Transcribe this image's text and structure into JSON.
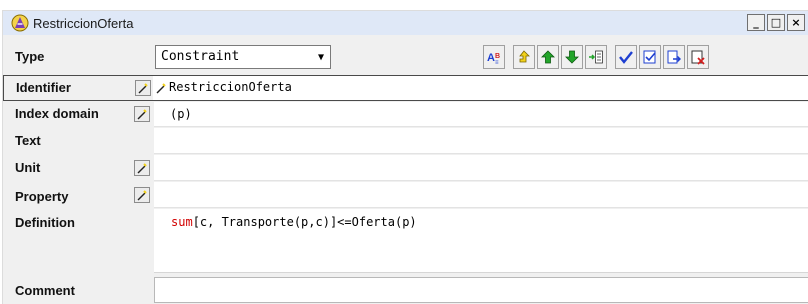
{
  "window": {
    "title": "RestriccionOferta",
    "controls": {
      "minimize": "_",
      "maximize": "□",
      "close": "×"
    }
  },
  "type_field": {
    "label": "Type",
    "selected_value": "Constraint"
  },
  "toolbar": {
    "buttons": [
      {
        "name": "spell-check-icon",
        "glyph": "A"
      },
      {
        "name": "move-up-level-icon",
        "glyph": "↰"
      },
      {
        "name": "move-up-icon",
        "glyph": "↑"
      },
      {
        "name": "move-down-icon",
        "glyph": "↓"
      },
      {
        "name": "insert-icon",
        "glyph": "+"
      },
      {
        "name": "check-icon",
        "glyph": "✓"
      },
      {
        "name": "compile-icon",
        "glyph": "▣"
      },
      {
        "name": "export-icon",
        "glyph": "→"
      },
      {
        "name": "delete-icon",
        "glyph": "✕"
      }
    ]
  },
  "fields": {
    "identifier": {
      "label": "Identifier",
      "value": "RestriccionOferta"
    },
    "index_domain": {
      "label": "Index domain",
      "value": "(p)"
    },
    "text": {
      "label": "Text",
      "value": ""
    },
    "unit": {
      "label": "Unit",
      "value": ""
    },
    "property": {
      "label": "Property",
      "value": ""
    },
    "definition": {
      "label": "Definition",
      "keyword": "sum",
      "rest": "[c, Transporte(p,c)]<=Oferta(p)"
    },
    "comment": {
      "label": "Comment",
      "value": ""
    }
  },
  "colors": {
    "titlebar": "#dfe8f7",
    "panel": "#f0f0f0",
    "keyword": "#d20000",
    "arrow_yellow": "#f2d21b",
    "arrow_green": "#22a52a",
    "check_blue": "#1e3fd1",
    "delete_red": "#d11e1e"
  }
}
